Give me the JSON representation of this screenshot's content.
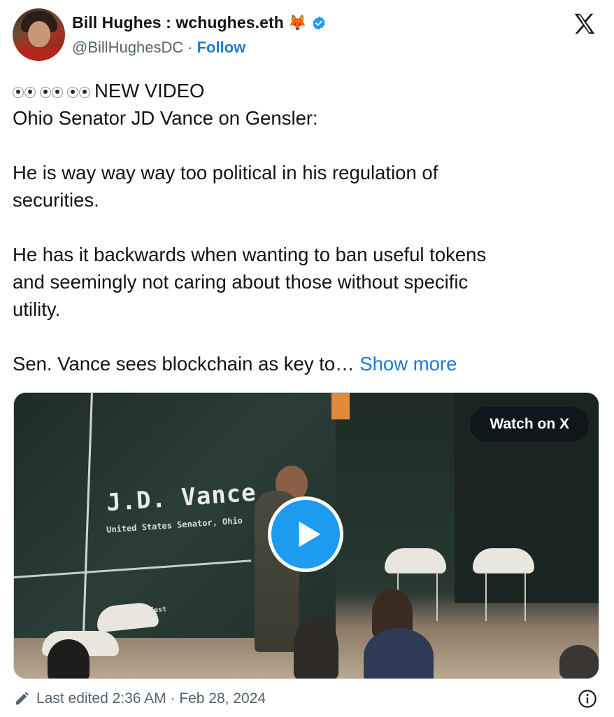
{
  "author": {
    "display_name": "Bill Hughes : wchughes.eth",
    "name_emoji": "🦊",
    "handle": "@BillHughesDC",
    "separator": "·",
    "follow_label": "Follow"
  },
  "tweet": {
    "line1": "NEW VIDEO",
    "line2": "Ohio Senator JD Vance on Gensler:",
    "para2_line1": "He is way way way too political in his regulation of",
    "para2_line2": "securities.",
    "para3_line1": "He has it backwards when wanting to ban useful tokens",
    "para3_line2": "and seemingly not caring about those without specific",
    "para3_line3": "utility.",
    "para4": "Sen. Vance sees blockchain as key to…",
    "show_more_label": "Show more"
  },
  "media": {
    "watch_label": "Watch on X",
    "caption_name": "J.D. Vance",
    "caption_title": "United States Senator, Ohio",
    "caption_fest": "yfest"
  },
  "footer": {
    "edited_text": "Last edited 2:36 AM · Feb 28, 2024"
  },
  "colors": {
    "link_blue": "#1d7bd4",
    "play_blue": "#1d9bf0",
    "muted_text": "#536471"
  },
  "icons": [
    "x-logo-icon",
    "verified-badge-icon",
    "eyes-emoji-icon",
    "play-icon",
    "pencil-icon",
    "info-icon"
  ]
}
